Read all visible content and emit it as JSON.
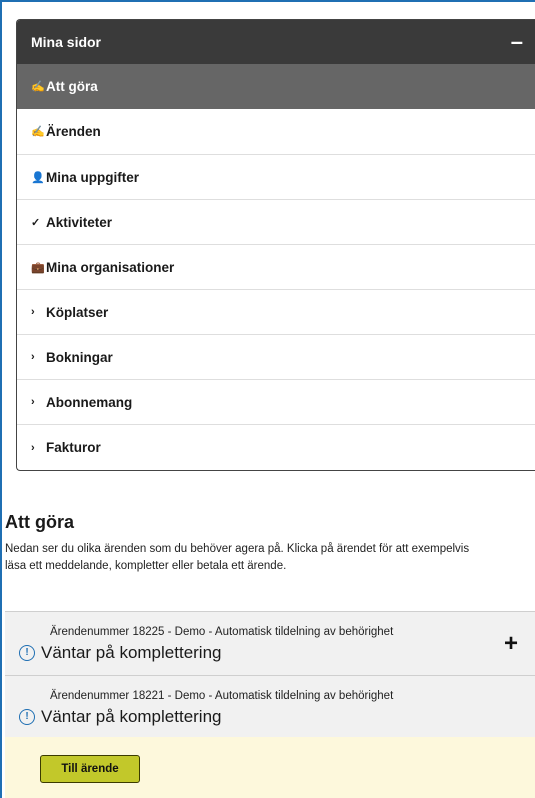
{
  "menu": {
    "header": "Mina sidor",
    "collapse_symbol": "–",
    "items": [
      {
        "icon": "✍",
        "label": "Att göra"
      },
      {
        "icon": "✍",
        "label": "Ärenden"
      },
      {
        "icon": "👤",
        "label": "Mina uppgifter"
      },
      {
        "icon": "✓",
        "label": "Aktiviteter"
      },
      {
        "icon": "💼",
        "label": "Mina organisationer"
      },
      {
        "icon": "›",
        "label": "Köplatser"
      },
      {
        "icon": "›",
        "label": "Bokningar"
      },
      {
        "icon": "›",
        "label": "Abonnemang"
      },
      {
        "icon": "›",
        "label": "Fakturor"
      }
    ]
  },
  "main": {
    "title": "Att göra",
    "intro_line1": "Nedan ser du olika ärenden som du behöver agera på. Klicka på ärendet för att exempelvis",
    "intro_line2": "läsa ett meddelande, kompletter eller betala ett ärende.",
    "cases": [
      {
        "number": "Ärendenummer 18225 - Demo - Automatisk tildelning av behörighet",
        "status": "Väntar på komplettering",
        "expand_symbol": "+"
      },
      {
        "number": "Ärendenummer 18221 - Demo - Automatisk tildelning av behörighet",
        "status": "Väntar på komplettering",
        "button_label": "Till ärende"
      }
    ]
  },
  "colors": {
    "accent_blue": "#1f6fb3",
    "header_dark": "#3a3a3a",
    "active_item": "#666666",
    "button_lime": "#c2c82a",
    "action_bg": "#fdf8dc"
  }
}
